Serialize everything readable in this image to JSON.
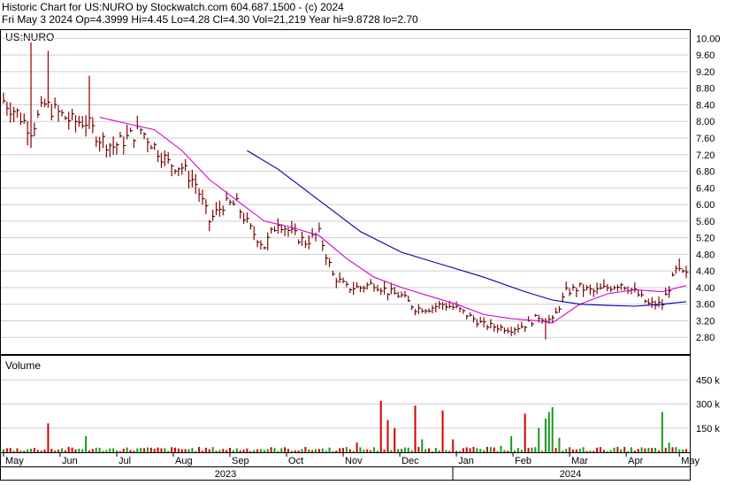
{
  "header": {
    "line1": "Historic Chart for US:NURO by Stockwatch.com 604.687.1500 - (c) 2024",
    "line2": "Fri May  3 2024  Op=4.3999  Hi=4.45  Lo=4.28  Cl=4.30  Vol=21,219  Year hi=9.8728  lo=2.70"
  },
  "colors": {
    "bar": "#8b0000",
    "ma_short": "#d400d4",
    "ma_long": "#0000b0",
    "vol_up": "#1a9a1a",
    "vol_down": "#d40000",
    "frame": "#000000"
  },
  "chart_data": [
    {
      "type": "candlestick",
      "symbol_label": "US:NURO",
      "ylim": [
        2.4,
        10.2
      ],
      "y_ticks": [
        "10.00",
        "9.60",
        "9.20",
        "8.80",
        "8.40",
        "8.00",
        "7.60",
        "7.20",
        "6.80",
        "6.40",
        "6.00",
        "5.60",
        "5.20",
        "4.80",
        "4.40",
        "4.00",
        "3.60",
        "3.20",
        "2.80"
      ],
      "x_months": [
        "May",
        "Jun",
        "Jul",
        "Aug",
        "Sep",
        "Oct",
        "Nov",
        "Dec",
        "Jan",
        "Feb",
        "Mar",
        "Apr",
        "May"
      ],
      "x_years": [
        "2023",
        "2024"
      ],
      "price_anchors": [
        {
          "x": 0,
          "y": 8.5
        },
        {
          "x": 4,
          "y": 8.2
        },
        {
          "x": 8,
          "y": 7.8
        },
        {
          "x": 12,
          "y": 8.4
        },
        {
          "x": 16,
          "y": 8.2
        },
        {
          "x": 20,
          "y": 8.0
        },
        {
          "x": 24,
          "y": 8.0
        },
        {
          "x": 28,
          "y": 7.6
        },
        {
          "x": 32,
          "y": 7.4
        },
        {
          "x": 36,
          "y": 7.6
        },
        {
          "x": 40,
          "y": 7.8
        },
        {
          "x": 44,
          "y": 7.4
        },
        {
          "x": 48,
          "y": 7.0
        },
        {
          "x": 52,
          "y": 6.9
        },
        {
          "x": 56,
          "y": 6.5
        },
        {
          "x": 60,
          "y": 5.6
        },
        {
          "x": 64,
          "y": 6.0
        },
        {
          "x": 68,
          "y": 6.0
        },
        {
          "x": 72,
          "y": 5.4
        },
        {
          "x": 76,
          "y": 5.0
        },
        {
          "x": 80,
          "y": 5.6
        },
        {
          "x": 84,
          "y": 5.3
        },
        {
          "x": 88,
          "y": 5.1
        },
        {
          "x": 92,
          "y": 5.3
        },
        {
          "x": 96,
          "y": 4.3
        },
        {
          "x": 100,
          "y": 4.0
        },
        {
          "x": 104,
          "y": 4.0
        },
        {
          "x": 108,
          "y": 4.1
        },
        {
          "x": 112,
          "y": 3.9
        },
        {
          "x": 116,
          "y": 3.8
        },
        {
          "x": 120,
          "y": 3.5
        },
        {
          "x": 124,
          "y": 3.5
        },
        {
          "x": 128,
          "y": 3.6
        },
        {
          "x": 132,
          "y": 3.5
        },
        {
          "x": 136,
          "y": 3.3
        },
        {
          "x": 140,
          "y": 3.1
        },
        {
          "x": 144,
          "y": 3.05
        },
        {
          "x": 148,
          "y": 3.0
        },
        {
          "x": 152,
          "y": 3.1
        },
        {
          "x": 156,
          "y": 3.3
        },
        {
          "x": 160,
          "y": 3.2
        },
        {
          "x": 164,
          "y": 3.9
        },
        {
          "x": 168,
          "y": 4.0
        },
        {
          "x": 172,
          "y": 3.9
        },
        {
          "x": 176,
          "y": 4.0
        },
        {
          "x": 180,
          "y": 4.1
        },
        {
          "x": 184,
          "y": 3.9
        },
        {
          "x": 188,
          "y": 3.6
        },
        {
          "x": 192,
          "y": 3.6
        },
        {
          "x": 196,
          "y": 4.4
        },
        {
          "x": 199,
          "y": 4.3
        }
      ],
      "spikes": [
        {
          "x": 8,
          "y": 9.9
        },
        {
          "x": 13,
          "y": 9.7
        },
        {
          "x": 25,
          "y": 9.1
        },
        {
          "x": 77,
          "y": 4.9
        },
        {
          "x": 158,
          "y": 2.75
        },
        {
          "x": 197,
          "y": 4.7
        }
      ],
      "series": [
        {
          "name": "ma_short",
          "points": [
            {
              "x": 28,
              "y": 8.1
            },
            {
              "x": 36,
              "y": 7.95
            },
            {
              "x": 44,
              "y": 7.8
            },
            {
              "x": 52,
              "y": 7.3
            },
            {
              "x": 60,
              "y": 6.6
            },
            {
              "x": 68,
              "y": 6.1
            },
            {
              "x": 76,
              "y": 5.6
            },
            {
              "x": 84,
              "y": 5.45
            },
            {
              "x": 92,
              "y": 5.25
            },
            {
              "x": 100,
              "y": 4.7
            },
            {
              "x": 108,
              "y": 4.25
            },
            {
              "x": 116,
              "y": 4.0
            },
            {
              "x": 124,
              "y": 3.8
            },
            {
              "x": 132,
              "y": 3.6
            },
            {
              "x": 140,
              "y": 3.35
            },
            {
              "x": 148,
              "y": 3.25
            },
            {
              "x": 156,
              "y": 3.2
            },
            {
              "x": 160,
              "y": 3.15
            },
            {
              "x": 168,
              "y": 3.6
            },
            {
              "x": 176,
              "y": 3.85
            },
            {
              "x": 184,
              "y": 3.95
            },
            {
              "x": 192,
              "y": 3.9
            },
            {
              "x": 199,
              "y": 4.05
            }
          ]
        },
        {
          "name": "ma_long",
          "points": [
            {
              "x": 71,
              "y": 7.3
            },
            {
              "x": 80,
              "y": 6.85
            },
            {
              "x": 92,
              "y": 6.1
            },
            {
              "x": 104,
              "y": 5.35
            },
            {
              "x": 116,
              "y": 4.85
            },
            {
              "x": 128,
              "y": 4.55
            },
            {
              "x": 140,
              "y": 4.25
            },
            {
              "x": 152,
              "y": 3.9
            },
            {
              "x": 160,
              "y": 3.7
            },
            {
              "x": 168,
              "y": 3.6
            },
            {
              "x": 176,
              "y": 3.57
            },
            {
              "x": 184,
              "y": 3.55
            },
            {
              "x": 192,
              "y": 3.6
            },
            {
              "x": 199,
              "y": 3.66
            }
          ]
        }
      ]
    },
    {
      "type": "bar",
      "panel_label": "Volume",
      "ylim": [
        0,
        600000
      ],
      "y_ticks": [
        "450 k",
        "300 k",
        "150 k"
      ],
      "y_tick_values": [
        450000,
        300000,
        150000
      ],
      "peaks": [
        {
          "x": 13,
          "v": 180000,
          "up": false
        },
        {
          "x": 24,
          "v": 100000,
          "up": true
        },
        {
          "x": 46,
          "v": 25000,
          "up": false
        },
        {
          "x": 103,
          "v": 60000,
          "up": false
        },
        {
          "x": 110,
          "v": 320000,
          "up": false
        },
        {
          "x": 112,
          "v": 200000,
          "up": false
        },
        {
          "x": 114,
          "v": 150000,
          "up": false
        },
        {
          "x": 120,
          "v": 290000,
          "up": false
        },
        {
          "x": 122,
          "v": 80000,
          "up": true
        },
        {
          "x": 128,
          "v": 260000,
          "up": false
        },
        {
          "x": 131,
          "v": 80000,
          "up": false
        },
        {
          "x": 145,
          "v": 40000,
          "up": true
        },
        {
          "x": 148,
          "v": 100000,
          "up": true
        },
        {
          "x": 152,
          "v": 240000,
          "up": false
        },
        {
          "x": 156,
          "v": 150000,
          "up": true
        },
        {
          "x": 158,
          "v": 210000,
          "up": true
        },
        {
          "x": 159,
          "v": 250000,
          "up": true
        },
        {
          "x": 160,
          "v": 280000,
          "up": true
        },
        {
          "x": 162,
          "v": 90000,
          "up": true
        },
        {
          "x": 192,
          "v": 250000,
          "up": true
        },
        {
          "x": 194,
          "v": 60000,
          "up": true
        }
      ],
      "base_volume": 20000
    }
  ]
}
